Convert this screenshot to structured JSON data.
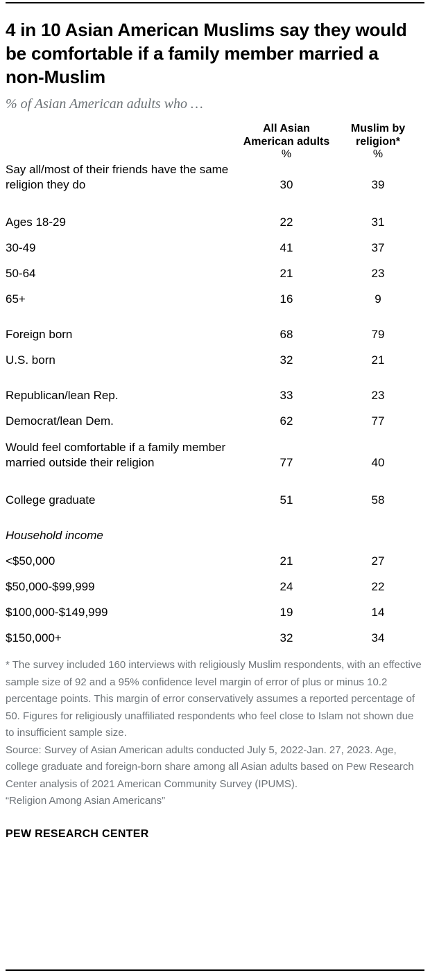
{
  "header": {
    "title": "4 in 10 Asian American Muslims say they would be comfortable if a family member married a non-Muslim",
    "subtitle": "% of Asian American adults who …"
  },
  "table": {
    "columns": [
      {
        "label": "All Asian American adults",
        "unit": "%"
      },
      {
        "label": "Muslim by religion*",
        "unit": "%"
      }
    ],
    "rows": [
      {
        "label": "Say all/most of their friends have the same religion they do",
        "v1": "30",
        "v2": "39",
        "type": "data",
        "multiline": true
      },
      {
        "label": "Ages 18-29",
        "v1": "22",
        "v2": "31",
        "type": "data"
      },
      {
        "label": "30-49",
        "v1": "41",
        "v2": "37",
        "type": "data"
      },
      {
        "label": "50-64",
        "v1": "21",
        "v2": "23",
        "type": "data"
      },
      {
        "label": "65+",
        "v1": "16",
        "v2": "9",
        "type": "data"
      },
      {
        "label": "Foreign born",
        "v1": "68",
        "v2": "79",
        "type": "data"
      },
      {
        "label": "U.S. born",
        "v1": "32",
        "v2": "21",
        "type": "data"
      },
      {
        "label": "Republican/lean Rep.",
        "v1": "33",
        "v2": "23",
        "type": "data"
      },
      {
        "label": "Democrat/lean Dem.",
        "v1": "62",
        "v2": "77",
        "type": "data"
      },
      {
        "label": "Would feel comfortable if a family member married outside their religion",
        "v1": "77",
        "v2": "40",
        "type": "data",
        "multiline": true
      },
      {
        "label": "College graduate",
        "v1": "51",
        "v2": "58",
        "type": "data"
      },
      {
        "label": "Household income",
        "type": "subhead"
      },
      {
        "label": "<$50,000",
        "v1": "21",
        "v2": "27",
        "type": "data"
      },
      {
        "label": "$50,000-$99,999",
        "v1": "24",
        "v2": "22",
        "type": "data"
      },
      {
        "label": "$100,000-$149,999",
        "v1": "19",
        "v2": "14",
        "type": "data"
      },
      {
        "label": "$150,000+",
        "v1": "32",
        "v2": "34",
        "type": "data"
      }
    ]
  },
  "notes": {
    "footnote": "* The survey included 160 interviews with religiously Muslim respondents, with an effective sample size of 92 and a 95% confidence level margin of error of plus or minus 10.2 percentage points. This margin of error conservatively assumes a reported percentage of 50. Figures for religiously unaffiliated respondents who feel close to Islam not shown due to insufficient sample size.",
    "source": "Source: Survey of Asian American adults conducted July 5, 2022-Jan. 27, 2023. Age, college graduate and foreign-born share among all Asian adults based on Pew Research Center analysis of 2021 American Community Survey (IPUMS).",
    "report": "“Religion Among Asian Americans”"
  },
  "footer": {
    "brand": "PEW RESEARCH CENTER"
  },
  "chart_data": {
    "type": "table",
    "title": "4 in 10 Asian American Muslims say they would be comfortable if a family member married a non-Muslim",
    "subtitle": "% of Asian American adults who …",
    "columns": [
      "",
      "All Asian American adults %",
      "Muslim by religion* %"
    ],
    "categories": [
      "Say all/most of their friends have the same religion they do",
      "Ages 18-29",
      "30-49",
      "50-64",
      "65+",
      "Foreign born",
      "U.S. born",
      "Republican/lean Rep.",
      "Democrat/lean Dem.",
      "Would feel comfortable if a family member married outside their religion",
      "College graduate",
      "<$50,000",
      "$50,000-$99,999",
      "$100,000-$149,999",
      "$150,000+"
    ],
    "series": [
      {
        "name": "All Asian American adults",
        "values": [
          30,
          22,
          41,
          21,
          16,
          68,
          32,
          33,
          62,
          77,
          51,
          21,
          24,
          19,
          32
        ]
      },
      {
        "name": "Muslim by religion*",
        "values": [
          39,
          31,
          37,
          23,
          9,
          79,
          21,
          23,
          77,
          40,
          58,
          27,
          22,
          14,
          34
        ]
      }
    ],
    "ylabel": "%",
    "xlabel": ""
  }
}
